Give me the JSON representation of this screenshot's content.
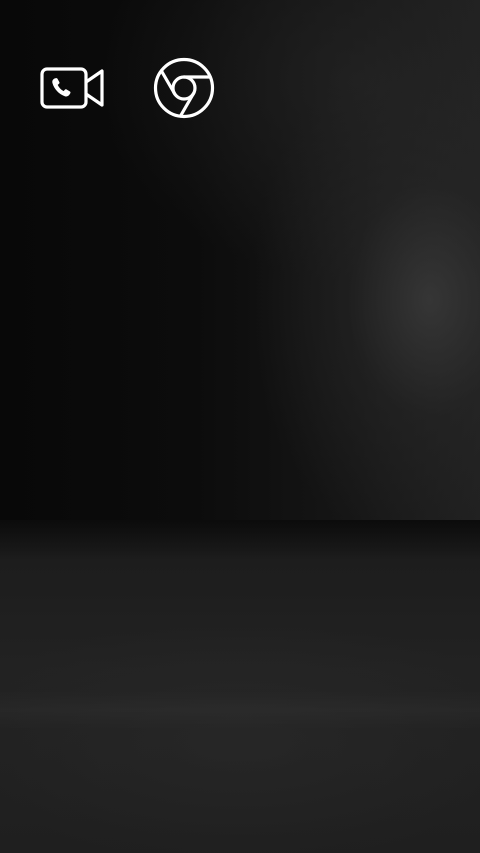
{
  "home_screen": {
    "apps": [
      {
        "icon": "video-call-icon",
        "accent": "#ffffff"
      },
      {
        "icon": "chrome-icon",
        "accent": "#ffffff"
      }
    ]
  },
  "theme": {
    "background": "#0b0b0b",
    "icon_stroke": "#ffffff"
  }
}
